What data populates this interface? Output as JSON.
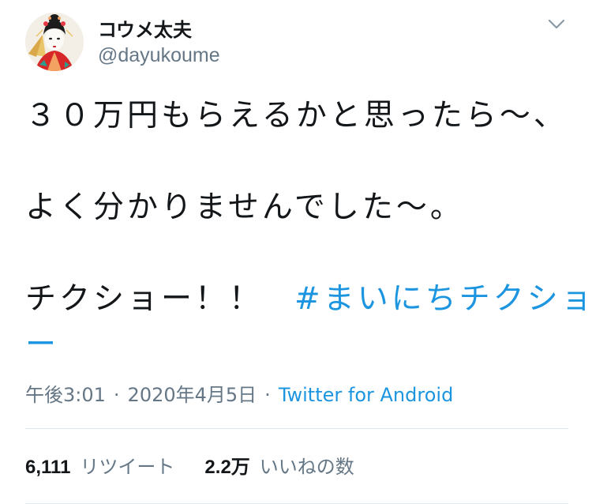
{
  "author": {
    "display_name": "コウメ太夫",
    "handle": "@dayukoume"
  },
  "tweet": {
    "line1": "３０万円もらえるかと思ったら〜、",
    "line2": "よく分かりませんでした〜。",
    "line3": "チクショー！！",
    "hashtag_part1": "#まいにちチクショ",
    "hashtag_part2": "ー"
  },
  "meta": {
    "time": "午後3:01",
    "separator": "·",
    "date": "2020年4月5日",
    "source": "Twitter for Android"
  },
  "stats": {
    "retweets_count": "6,111",
    "retweets_label": "リツイート",
    "likes_count": "2.2万",
    "likes_label": "いいねの数"
  },
  "icons": {
    "menu": "chevron-down-icon",
    "avatar": "avatar"
  },
  "colors": {
    "link": "#1b95e0",
    "secondary": "#657786",
    "text": "#14171a",
    "divider": "#e1e8ed"
  }
}
